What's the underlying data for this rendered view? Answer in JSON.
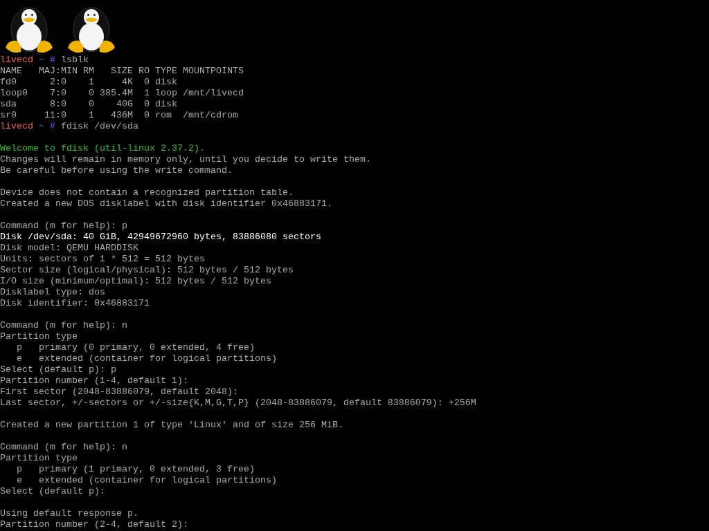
{
  "console": {
    "lines": [
      {
        "kind": "prompt",
        "host": "livecd",
        "dir": "~",
        "symbol": "#",
        "command": "lsblk"
      },
      {
        "kind": "text",
        "color": "#aaaaaa",
        "text": "NAME   MAJ:MIN RM   SIZE RO TYPE MOUNTPOINTS"
      },
      {
        "kind": "text",
        "color": "#aaaaaa",
        "text": "fd0      2:0    1     4K  0 disk"
      },
      {
        "kind": "text",
        "color": "#aaaaaa",
        "text": "loop0    7:0    0 385.4M  1 loop /mnt/livecd"
      },
      {
        "kind": "text",
        "color": "#aaaaaa",
        "text": "sda      8:0    0    40G  0 disk"
      },
      {
        "kind": "text",
        "color": "#aaaaaa",
        "text": "sr0     11:0    1   436M  0 rom  /mnt/cdrom"
      },
      {
        "kind": "prompt",
        "host": "livecd",
        "dir": "~",
        "symbol": "#",
        "command": "fdisk /dev/sda"
      },
      {
        "kind": "blank"
      },
      {
        "kind": "text",
        "color": "#2ec02e",
        "text": "Welcome to fdisk (util-linux 2.37.2)."
      },
      {
        "kind": "text",
        "color": "#aaaaaa",
        "text": "Changes will remain in memory only, until you decide to write them."
      },
      {
        "kind": "text",
        "color": "#aaaaaa",
        "text": "Be careful before using the write command."
      },
      {
        "kind": "blank"
      },
      {
        "kind": "text",
        "color": "#aaaaaa",
        "text": "Device does not contain a recognized partition table."
      },
      {
        "kind": "text",
        "color": "#aaaaaa",
        "text": "Created a new DOS disklabel with disk identifier 0x46883171."
      },
      {
        "kind": "blank"
      },
      {
        "kind": "text",
        "color": "#aaaaaa",
        "text": "Command (m for help): p"
      },
      {
        "kind": "text",
        "color": "#ffffff",
        "text": "Disk /dev/sda: 40 GiB, 42949672960 bytes, 83886080 sectors"
      },
      {
        "kind": "text",
        "color": "#aaaaaa",
        "text": "Disk model: QEMU HARDDISK"
      },
      {
        "kind": "text",
        "color": "#aaaaaa",
        "text": "Units: sectors of 1 * 512 = 512 bytes"
      },
      {
        "kind": "text",
        "color": "#aaaaaa",
        "text": "Sector size (logical/physical): 512 bytes / 512 bytes"
      },
      {
        "kind": "text",
        "color": "#aaaaaa",
        "text": "I/O size (minimum/optimal): 512 bytes / 512 bytes"
      },
      {
        "kind": "text",
        "color": "#aaaaaa",
        "text": "Disklabel type: dos"
      },
      {
        "kind": "text",
        "color": "#aaaaaa",
        "text": "Disk identifier: 0x46883171"
      },
      {
        "kind": "blank"
      },
      {
        "kind": "text",
        "color": "#aaaaaa",
        "text": "Command (m for help): n"
      },
      {
        "kind": "text",
        "color": "#aaaaaa",
        "text": "Partition type"
      },
      {
        "kind": "text",
        "color": "#aaaaaa",
        "text": "   p   primary (0 primary, 0 extended, 4 free)"
      },
      {
        "kind": "text",
        "color": "#aaaaaa",
        "text": "   e   extended (container for logical partitions)"
      },
      {
        "kind": "text",
        "color": "#aaaaaa",
        "text": "Select (default p): p"
      },
      {
        "kind": "text",
        "color": "#aaaaaa",
        "text": "Partition number (1-4, default 1):"
      },
      {
        "kind": "text",
        "color": "#aaaaaa",
        "text": "First sector (2048-83886079, default 2048):"
      },
      {
        "kind": "text",
        "color": "#aaaaaa",
        "text": "Last sector, +/-sectors or +/-size{K,M,G,T,P} (2048-83886079, default 83886079): +256M"
      },
      {
        "kind": "blank"
      },
      {
        "kind": "text",
        "color": "#aaaaaa",
        "text": "Created a new partition 1 of type 'Linux' and of size 256 MiB."
      },
      {
        "kind": "blank"
      },
      {
        "kind": "text",
        "color": "#aaaaaa",
        "text": "Command (m for help): n"
      },
      {
        "kind": "text",
        "color": "#aaaaaa",
        "text": "Partition type"
      },
      {
        "kind": "text",
        "color": "#aaaaaa",
        "text": "   p   primary (1 primary, 0 extended, 3 free)"
      },
      {
        "kind": "text",
        "color": "#aaaaaa",
        "text": "   e   extended (container for logical partitions)"
      },
      {
        "kind": "text",
        "color": "#aaaaaa",
        "text": "Select (default p):"
      },
      {
        "kind": "blank"
      },
      {
        "kind": "text",
        "color": "#aaaaaa",
        "text": "Using default response p."
      },
      {
        "kind": "text",
        "color": "#aaaaaa",
        "text": "Partition number (2-4, default 2):"
      }
    ]
  }
}
